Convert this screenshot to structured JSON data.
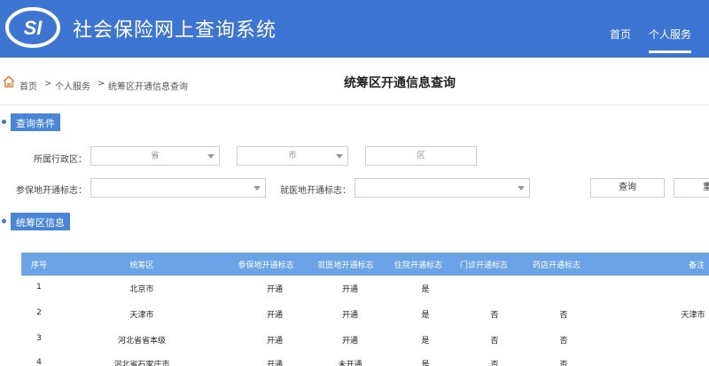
{
  "header": {
    "logo_text": "SI",
    "system_title": "社会保险网上查询系统",
    "nav": [
      {
        "label": "首页"
      },
      {
        "label": "个人服务"
      }
    ]
  },
  "breadcrumb": {
    "items": [
      "首页",
      "个人服务",
      "统筹区开通信息查询"
    ],
    "separator": ">"
  },
  "page_title": "统筹区开通信息查询",
  "query_section": {
    "title": "查询条件",
    "region_label": "所属行政区：",
    "province_placeholder": "省",
    "city_placeholder": "市",
    "district_placeholder": "区",
    "insured_label": "参保地开通标志：",
    "medical_label": "就医地开通标志：",
    "query_button": "查询",
    "reset_button_partial": "重"
  },
  "info_section": {
    "title": "统筹区信息",
    "columns": [
      "序号",
      "统筹区",
      "参保地开通标志",
      "就医地开通标志",
      "住院开通标志",
      "门诊开通标志",
      "药店开通标志",
      "备注"
    ],
    "rows": [
      {
        "no": "1",
        "area": "北京市",
        "insured": "开通",
        "medical": "开通",
        "inpatient": "是",
        "outpatient": "",
        "pharmacy": "",
        "remark": ""
      },
      {
        "no": "2",
        "area": "天津市",
        "insured": "开通",
        "medical": "开通",
        "inpatient": "是",
        "outpatient": "否",
        "pharmacy": "否",
        "remark": "天津市"
      },
      {
        "no": "3",
        "area": "河北省省本级",
        "insured": "开通",
        "medical": "开通",
        "inpatient": "是",
        "outpatient": "否",
        "pharmacy": "否",
        "remark": ""
      },
      {
        "no": "4",
        "area": "河北省石家庄市",
        "insured": "开通",
        "medical": "未开通",
        "inpatient": "是",
        "outpatient": "否",
        "pharmacy": "否",
        "remark": ""
      }
    ]
  },
  "colors": {
    "header_bg": "#3d75d2",
    "table_header_bg": "#6aa3e6",
    "home_icon": "#e8893c"
  },
  "icons": [
    "home-icon",
    "chevron-down-icon"
  ]
}
